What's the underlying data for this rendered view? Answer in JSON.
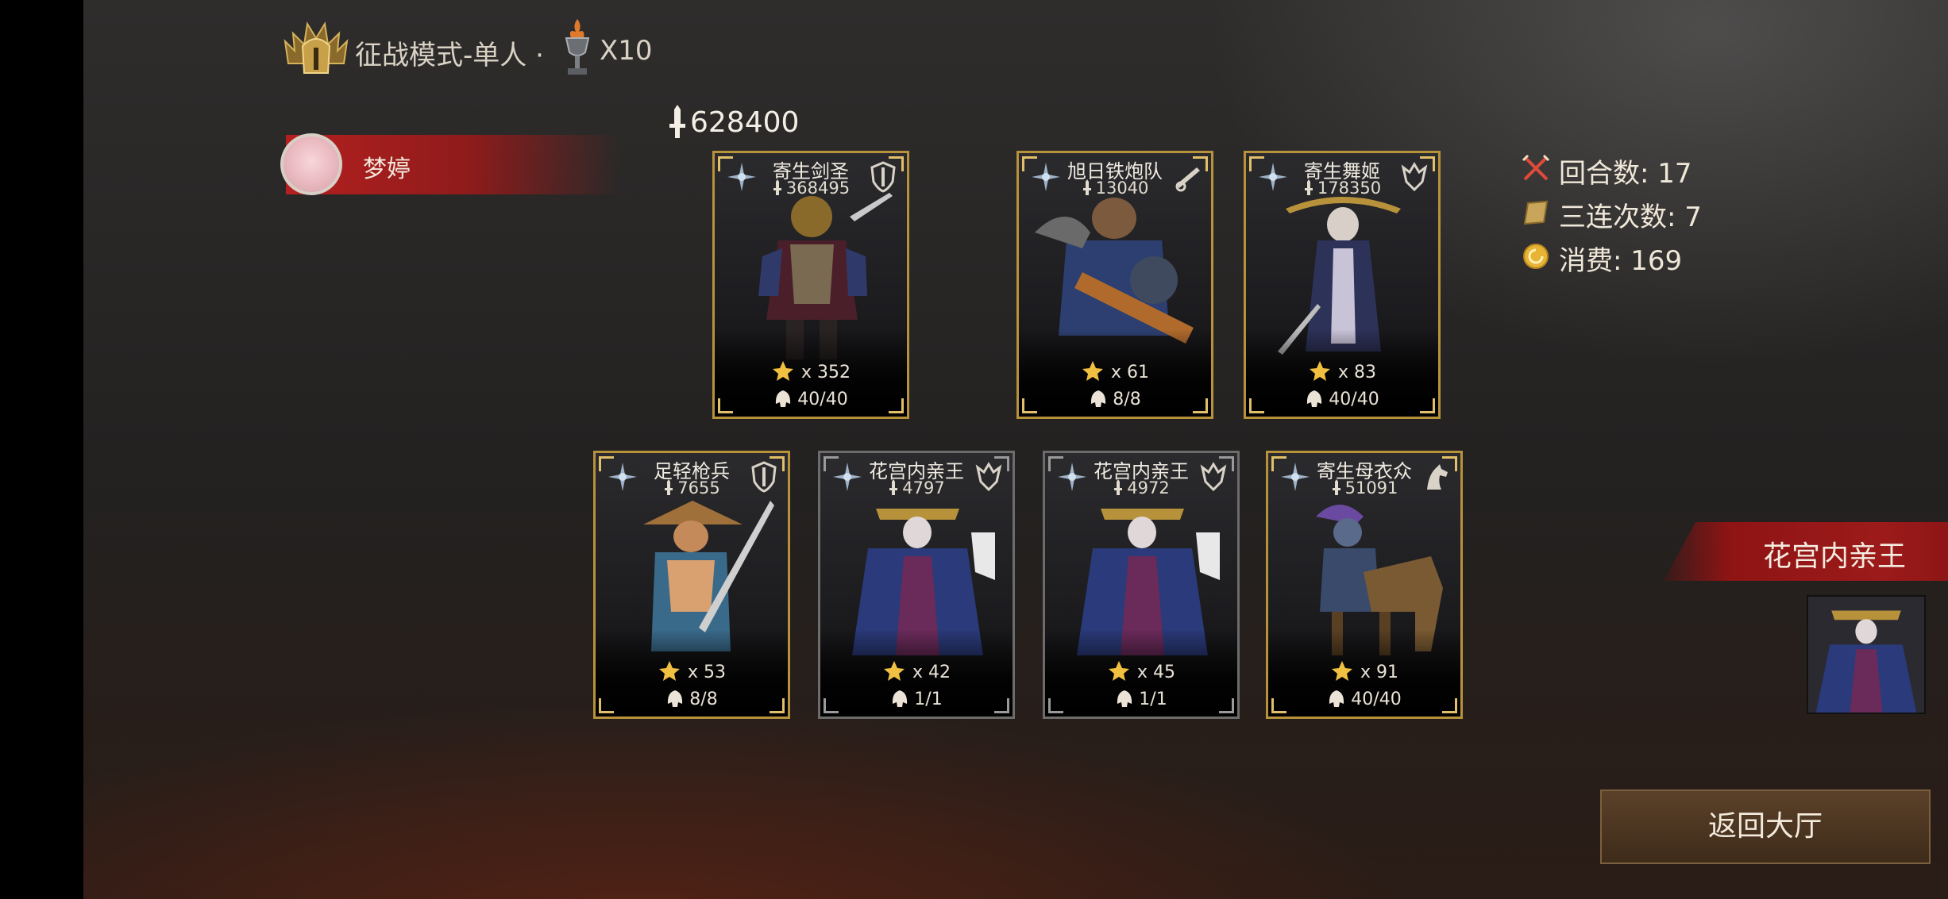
{
  "header": {
    "mode_label": "征战模式-单人 ·",
    "multiplier": "X10",
    "mode_icon": "helmet-emblem-icon",
    "trophy_icon": "trophy-cup-icon"
  },
  "player": {
    "name": "梦婷",
    "total_power": "628400"
  },
  "units": [
    {
      "name": "寄生剑圣",
      "power": "368495",
      "stars": "x 352",
      "count": "40/40",
      "class_icon": "shield-icon",
      "border": "gold"
    },
    {
      "name": "旭日铁炮队",
      "power": "13040",
      "stars": "x 61",
      "count": "8/8",
      "class_icon": "cannon-icon",
      "border": "gold"
    },
    {
      "name": "寄生舞姬",
      "power": "178350",
      "stars": "x 83",
      "count": "40/40",
      "class_icon": "crest-icon",
      "border": "gold"
    },
    {
      "name": "足轻枪兵",
      "power": "7655",
      "stars": "x 53",
      "count": "8/8",
      "class_icon": "shield-icon",
      "border": "gold"
    },
    {
      "name": "花宫内亲王",
      "power": "4797",
      "stars": "x 42",
      "count": "1/1",
      "class_icon": "crest-icon",
      "border": "gray"
    },
    {
      "name": "花宫内亲王",
      "power": "4972",
      "stars": "x 45",
      "count": "1/1",
      "class_icon": "crest-icon",
      "border": "gray"
    },
    {
      "name": "寄生母衣众",
      "power": "51091",
      "stars": "x 91",
      "count": "40/40",
      "class_icon": "horse-icon",
      "border": "gold"
    }
  ],
  "stats": {
    "rounds": "回合数: 17",
    "combos": "三连次数: 7",
    "cost": "消费: 169"
  },
  "enemy": {
    "name": "花宫内亲王"
  },
  "buttons": {
    "return_label": "返回大厅"
  },
  "colors": {
    "gold_border": "#b8923b",
    "gray_border": "#6c6c6c",
    "player_bar": "#b51f1f",
    "enemy_banner": "#9c1a1a",
    "button_bg": "#4b3522"
  }
}
